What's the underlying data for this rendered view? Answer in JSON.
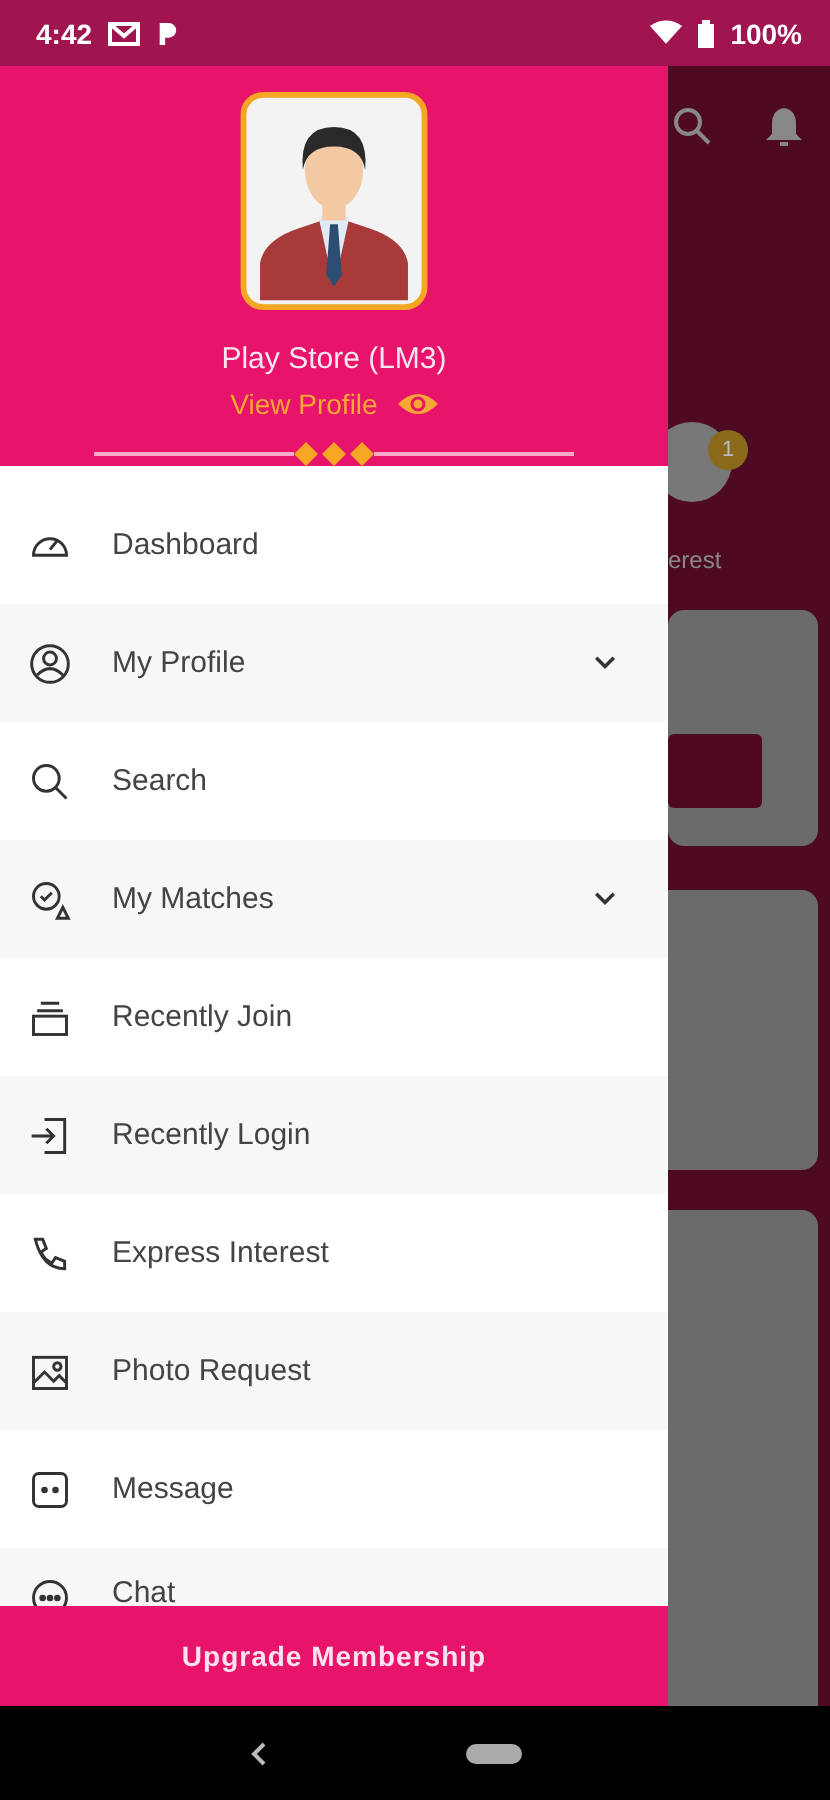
{
  "status_bar": {
    "time": "4:42",
    "battery": "100%"
  },
  "drawer": {
    "user_name": "Play Store (LM3)",
    "view_profile": "View Profile",
    "items": [
      {
        "label": "Dashboard",
        "expandable": false
      },
      {
        "label": "My Profile",
        "expandable": true
      },
      {
        "label": "Search",
        "expandable": false
      },
      {
        "label": "My Matches",
        "expandable": true
      },
      {
        "label": "Recently Join",
        "expandable": false
      },
      {
        "label": "Recently Login",
        "expandable": false
      },
      {
        "label": "Express Interest",
        "expandable": false
      },
      {
        "label": "Photo Request",
        "expandable": false
      },
      {
        "label": "Message",
        "expandable": false
      },
      {
        "label": "Chat",
        "expandable": false
      }
    ],
    "upgrade_button": "Upgrade Membership"
  },
  "background": {
    "label": "erest",
    "badge": "1"
  }
}
